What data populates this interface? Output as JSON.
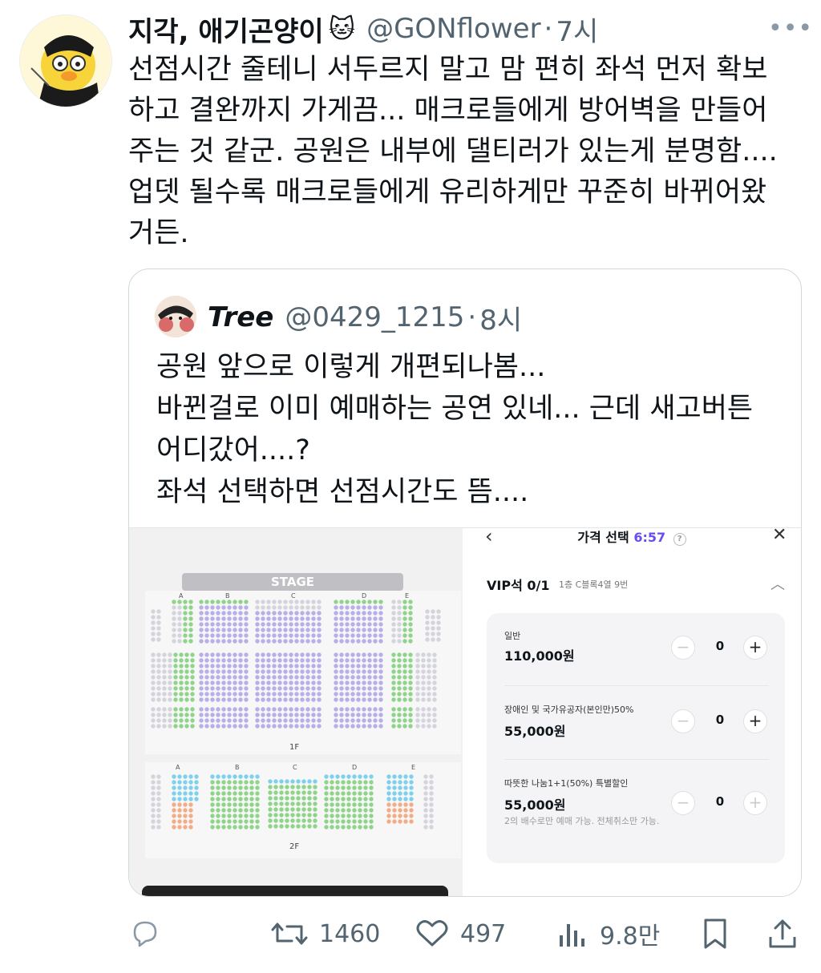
{
  "tweet": {
    "author_name": "지각, 애기곤양이",
    "author_emoji": "🐱",
    "handle": "@GONflower",
    "time": "7시",
    "more_icon": "more-icon",
    "lines": [
      "선점시간 줄테니 서두르지 말고 맘 편히 좌석 먼저 확보",
      "하고 결완까지 가게끔... 매크로들에게 방어벽을 만들어",
      "주는 것 같군. 공원은 내부에 댈티러가 있는게 분명함....",
      "업뎃 될수록 매크로들에게 유리하게만 꾸준히 바뀌어왔",
      "거든."
    ]
  },
  "quote": {
    "author_name": "Tree",
    "handle": "@0429_1215",
    "time": "8시",
    "lines": [
      "공원 앞으로 이렇게 개편되나봄...",
      "바뀐걸로 이미 예매하는 공연 있네... 근데 새고버튼",
      "어디갔어....?",
      "좌석 선택하면 선점시간도 뜸...."
    ]
  },
  "seatmap": {
    "stage": "STAGE",
    "floor1": "1F",
    "floor2": "2F",
    "sections": [
      "A",
      "B",
      "C",
      "D",
      "E"
    ]
  },
  "panel": {
    "title": "가격 선택",
    "timer": "6:57",
    "help": "?",
    "seat_grade": "VIP석 0/1",
    "seat_info": "1층 C블록4열 9번",
    "rows": [
      {
        "label": "일반",
        "price": "110,000원",
        "qty": "0",
        "note": ""
      },
      {
        "label": "장애인 및 국가유공자(본인만)50%",
        "price": "55,000원",
        "qty": "0",
        "note": ""
      },
      {
        "label": "따뜻한 나눔1+1(50%) 특별할인",
        "price": "55,000원",
        "qty": "0",
        "note": "2의 배수로만 예매 가능. 전체취소만 가능."
      }
    ]
  },
  "actions": {
    "retweets": "1460",
    "likes": "497",
    "views": "9.8만"
  },
  "colors": {
    "text": "#0f1419",
    "muted": "#536471",
    "border": "#cfd9de",
    "timer": "#6a4cf5",
    "seat_purple": "#b8aee8",
    "seat_green": "#8fd48a",
    "seat_blue": "#7fd0ec",
    "seat_orange": "#f2ad86",
    "seat_grey": "#d4d4dc"
  }
}
